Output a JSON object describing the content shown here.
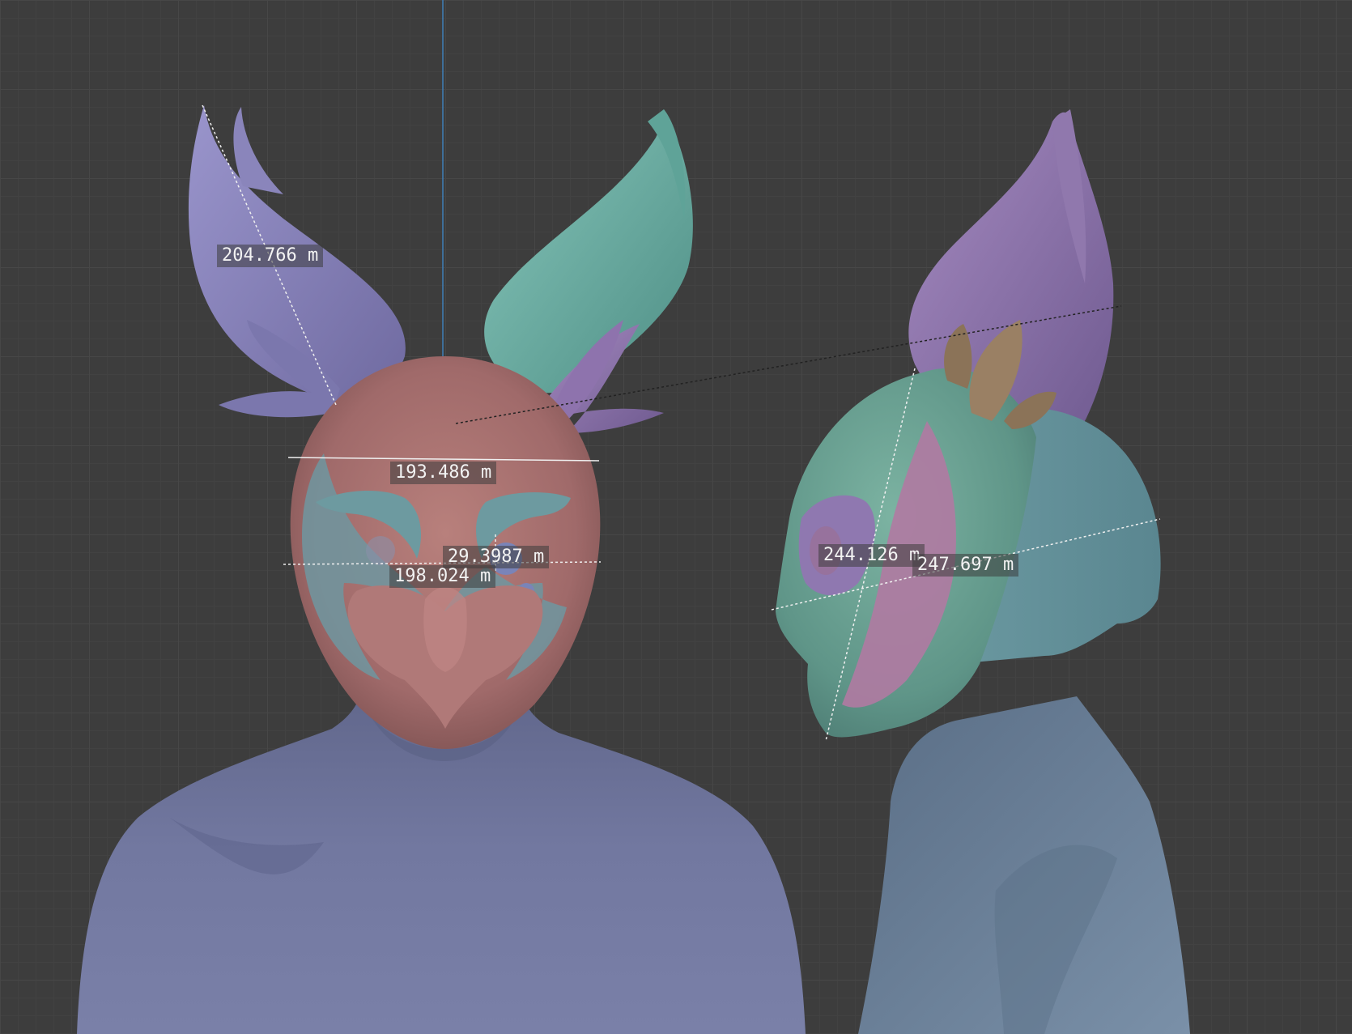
{
  "viewport": {
    "measurements": [
      {
        "id": "ear-length",
        "label": "204.766 m"
      },
      {
        "id": "head-width",
        "label": "193.486 m"
      },
      {
        "id": "eye-offset",
        "label": "29.3987 m"
      },
      {
        "id": "face-width",
        "label": "198.024 m"
      },
      {
        "id": "side-height",
        "label": "244.126 m"
      },
      {
        "id": "side-depth",
        "label": "247.697 m"
      }
    ]
  },
  "colors": {
    "background": "#3d3d3d",
    "grid": "#474747",
    "skin_front": "#6d7399",
    "skin_side": "#6f849a",
    "mask_front": "#a7706f",
    "mask_side": "#6fa596",
    "ear_purple": "#8c87be",
    "ear_teal": "#6db3a8",
    "accent_pink": "#b07aa2",
    "leaf_brown": "#8b7358"
  }
}
